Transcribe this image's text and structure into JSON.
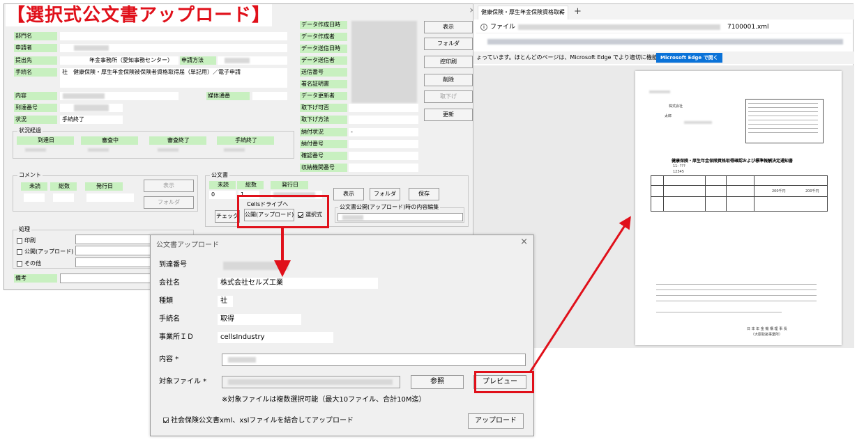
{
  "banner": {
    "title": "【選択式公文書アップロード】"
  },
  "main": {
    "left_labels": {
      "dept": "部門名",
      "applicant": "申請者",
      "submit_to": "提出先",
      "procedure": "手続名",
      "content": "内容",
      "arrival_no": "到達番号",
      "status": "状況"
    },
    "submit_to_value": "年金事務所（愛知事務センター）",
    "method_label": "申請方法",
    "procedure_value": "社　健康保険・厚生年金保険被保険者資格取得届（単記用）／電子申請",
    "media_label": "媒体通番",
    "status_value": "手続終了",
    "progress": {
      "title": "状況経過",
      "headers": [
        "到達日",
        "審査中",
        "審査終了",
        "手続終了"
      ]
    },
    "right_labels": [
      "データ作成日時",
      "データ作成者",
      "データ送信日時",
      "データ送信者",
      "送信番号",
      "署名証明書",
      "データ更新者",
      "取下げ可否",
      "取下げ方法",
      "納付状況",
      "納付番号",
      "確認番号",
      "収納機関番号"
    ],
    "payment_status_value": "-",
    "buttons": {
      "show": "表示",
      "folder": "フォルダ",
      "receipt": "控印刷",
      "delete": "削除",
      "withdraw": "取下げ",
      "update": "更新"
    },
    "comment": {
      "title": "コメント",
      "headers": [
        "未読",
        "総数",
        "発行日"
      ],
      "show_btn": "表示",
      "folder_btn": "フォルダ"
    },
    "kobunsho": {
      "title": "公文書",
      "headers": [
        "未読",
        "総数",
        "発行日"
      ],
      "unread": "0",
      "total": "1",
      "show_btn": "表示",
      "folder_btn": "フォルダ",
      "save_btn": "保存",
      "check_btn": "チェック",
      "cells_label": "Cellsドライブへ",
      "upload_btn": "公開(アップロード)",
      "select_checkbox": "選択式",
      "edit_group_title": "公文書公開(アップロード)時の内容編集"
    },
    "process": {
      "title": "処理",
      "items": [
        "印刷",
        "公開(アップロード)",
        "その他"
      ]
    },
    "remarks_label": "備考",
    "close_glyph": "×"
  },
  "dialog": {
    "title": "公文書アップロード",
    "close_glyph": "×",
    "labels": {
      "arrival_no": "到達番号",
      "company": "会社名",
      "type": "種類",
      "procedure": "手続名",
      "office_id": "事業所ＩＤ",
      "content": "内容 *",
      "file": "対象ファイル *"
    },
    "values": {
      "company": "株式会社セルズ工業",
      "type": "社",
      "procedure": "取得",
      "office_id": "cellsIndustry"
    },
    "browse_btn": "参照",
    "preview_btn": "プレビュー",
    "file_note": "※対象ファイルは複数選択可能（最大10ファイル、合計10M迄）",
    "combine_checkbox": "社会保険公文書xml、xslファイルを結合してアップロード",
    "upload_btn": "アップロード"
  },
  "browser": {
    "tab_title": "健康保険・厚生年金保険資格取得",
    "tab_close": "×",
    "new_tab": "+",
    "file_label": "ファイル",
    "url_tail": "7100001.xml",
    "notice": "ょっています。ほとんどのページは、Microsoft Edge でより適切に機能します。",
    "edge_btn": "Microsoft Edge で開く",
    "doc": {
      "title": "健康保険・厚生年金保険資格取得確認および標準報酬決定通知書",
      "company": "株式会社",
      "person": "太郎",
      "office_ref": "11- ???",
      "office_no": "12345",
      "amount1": "200千円",
      "amount2": "200千円",
      "issuer": "日 本 年 金 機 構 理 事 長",
      "issuer_sub": "（大臣取扱事業所）"
    }
  },
  "colors": {
    "label_green": "#c8f0c0",
    "highlight_red": "#e0101a",
    "edge_blue": "#0a72d8"
  }
}
